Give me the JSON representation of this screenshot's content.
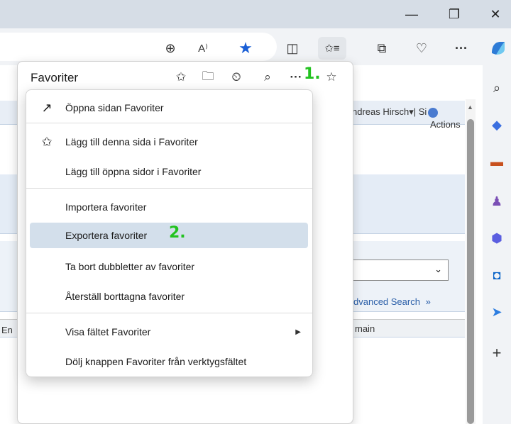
{
  "window_controls": {
    "minimize": "—",
    "restore": "❐",
    "close": "✕"
  },
  "toolbar": {
    "icons": [
      "zoom-icon",
      "read-aloud-icon",
      "favorite-star-icon",
      "split-screen-icon",
      "favorites-icon",
      "collections-icon",
      "browser-essentials-icon",
      "more-icon",
      "copilot-icon"
    ],
    "zoom_glyph": "⊕",
    "read_aloud_glyph": "A⁾",
    "star_glyph": "★",
    "split_glyph": "◫",
    "favorites_glyph": "✩≡",
    "collections_glyph": "⧉",
    "essentials_glyph": "♡",
    "more_glyph": "···"
  },
  "favorites_panel": {
    "title": "Favoriter",
    "tools": {
      "add_fav": "✩",
      "add_folder": "🗀",
      "history": "⏲",
      "search": "⌕",
      "more": "···",
      "pin": "☆"
    },
    "annotation_1": "1."
  },
  "menu": {
    "items": [
      {
        "label": "Öppna sidan Favoriter",
        "icon": "↗"
      },
      {
        "label": "Lägg till denna sida i Favoriter",
        "icon": "✩"
      },
      {
        "label": "Lägg till öppna sidor i Favoriter",
        "icon": ""
      },
      {
        "label": "Importera favoriter",
        "icon": ""
      },
      {
        "label": "Exportera favoriter",
        "icon": ""
      },
      {
        "label": "Ta bort dubbletter av favoriter",
        "icon": ""
      },
      {
        "label": "Återställ borttagna favoriter",
        "icon": ""
      },
      {
        "label": "Visa fältet Favoriter",
        "icon": ""
      },
      {
        "label": "Dölj knappen Favoriter från verktygsfältet",
        "icon": ""
      }
    ],
    "submenu_arrow": "▶",
    "annotation_2": "2."
  },
  "page_behind": {
    "user_text": "ndreas Hirsch▾| Si",
    "actions_text": "Actions",
    "advanced_search": "dvanced Search",
    "advanced_chevron": "»",
    "domain_text": "main",
    "left_fragment": "En"
  },
  "sidebar": {
    "icons": [
      "search-icon",
      "tag-icon",
      "toolbox-icon",
      "people-icon",
      "microsoft365-icon",
      "outlook-icon",
      "send-icon",
      "add-icon"
    ],
    "glyphs": [
      "⌕",
      "◆",
      "▬",
      "♟",
      "⬢",
      "◘",
      "➤",
      "+"
    ]
  },
  "colors": {
    "highlight": "#d3dfeb",
    "annotation": "#22c21f",
    "star": "#1a5fd6"
  }
}
